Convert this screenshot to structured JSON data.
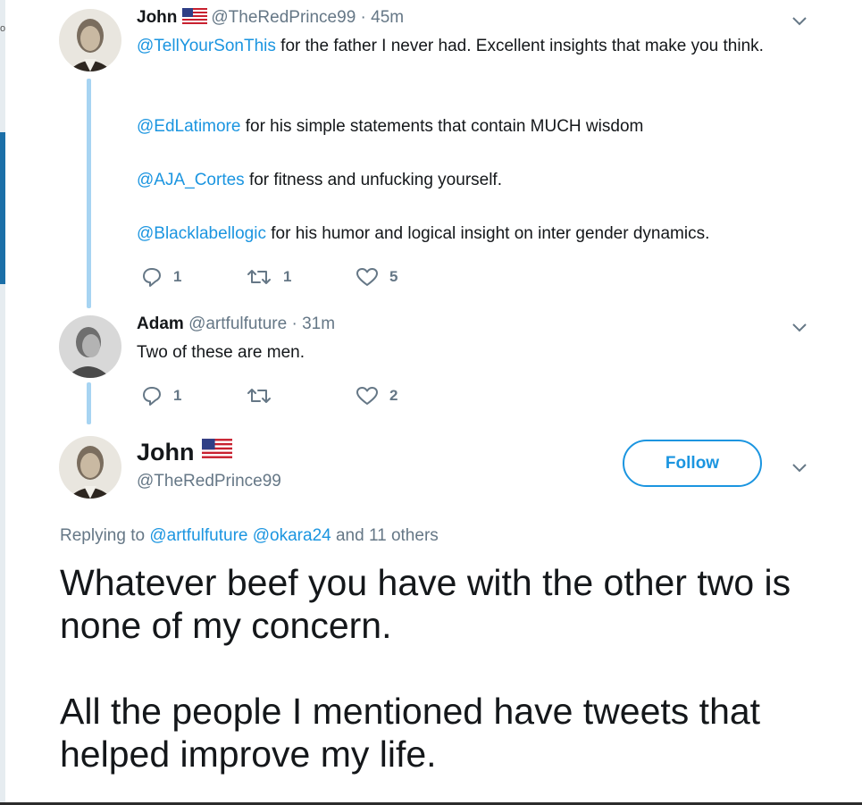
{
  "tweet1": {
    "name": "John",
    "handle": "@TheRedPrince99",
    "time": "45m",
    "lines": [
      {
        "mention": "@TellYourSonThis",
        "text": " for the father I never had. Excellent insights that make you think."
      },
      {
        "mention": "@EdLatimore",
        "text": " for his simple statements that contain MUCH wisdom"
      },
      {
        "mention": "@AJA_Cortes",
        "text": " for fitness and unfucking yourself."
      },
      {
        "mention": "@Blacklabellogic",
        "text": " for his humor and logical insight on inter gender dynamics."
      }
    ],
    "replies": "1",
    "retweets": "1",
    "likes": "5"
  },
  "tweet2": {
    "name": "Adam",
    "handle": "@artfulfuture",
    "time": "31m",
    "text": "Two of these are men.",
    "replies": "1",
    "retweets": "",
    "likes": "2"
  },
  "focus": {
    "name": "John",
    "handle": "@TheRedPrince99",
    "follow_label": "Follow",
    "replying_prefix": "Replying to",
    "replying_mention1": "@artfulfuture",
    "replying_mention2": "@okara24",
    "replying_suffix": "and 11 others",
    "paragraph1": "Whatever beef you have with the other two is none of my concern.",
    "paragraph2": "All the people I mentioned have tweets that helped improve my life."
  },
  "icons": {
    "reply": "reply-icon",
    "retweet": "retweet-icon",
    "like": "heart-icon",
    "more": "chevron-down-icon",
    "flag": "us-flag-icon"
  },
  "colors": {
    "link": "#1b95e0",
    "meta": "#657786",
    "thread_line": "#a7d4f2",
    "text": "#14171a"
  }
}
